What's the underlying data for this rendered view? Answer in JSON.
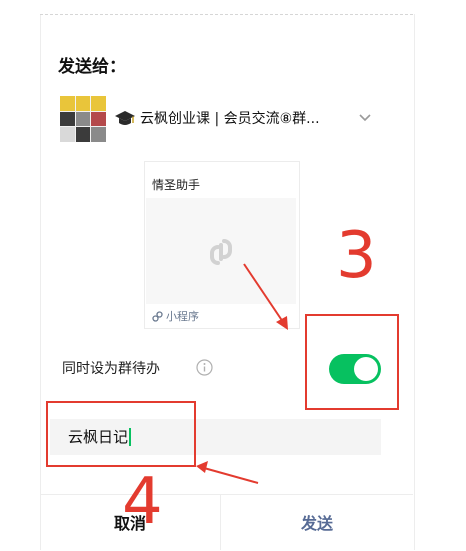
{
  "dialog": {
    "title": "发送给：",
    "recipient": {
      "name": "云枫创业课 | 会员交流⑧群...",
      "avatar_icon": "group-avatar-grid",
      "prefix_icon": "graduation-cap-icon",
      "expand_icon": "chevron-down-icon"
    },
    "mini_program_card": {
      "title": "情圣助手",
      "placeholder_icon": "link-icon",
      "footer_label": "小程序"
    },
    "group_todo": {
      "label": "同时设为群待办",
      "enabled": true
    },
    "message_input": {
      "value": "云枫日记"
    },
    "buttons": {
      "cancel": "取消",
      "send": "发送"
    }
  },
  "annotations": {
    "step3": "3",
    "step4": "4"
  },
  "colors": {
    "toggle_on": "#07c160",
    "send_text": "#576b95",
    "annotation_red": "#e33b2f"
  }
}
